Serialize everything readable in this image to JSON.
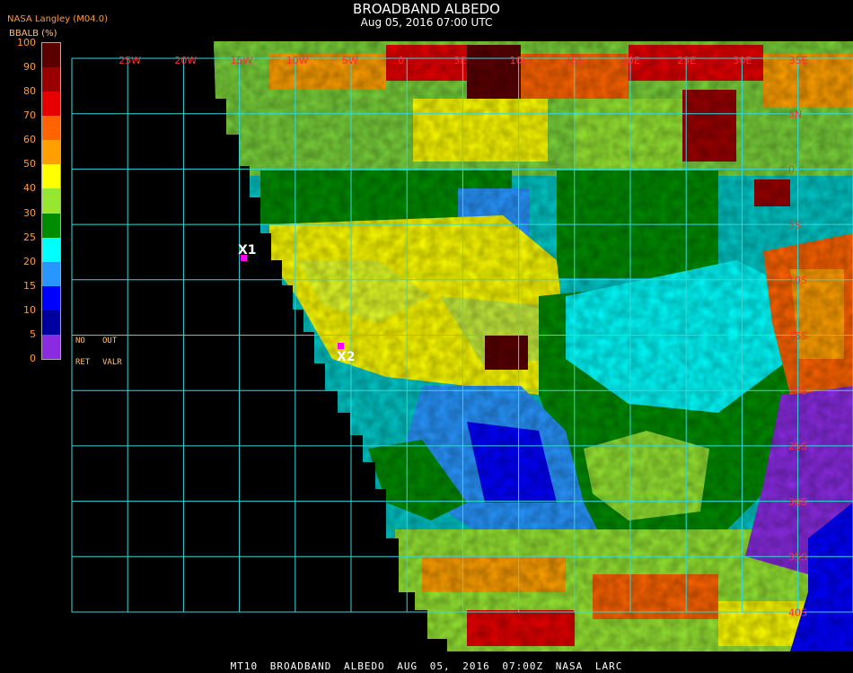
{
  "header": {
    "title": "BROADBAND ALBEDO",
    "subtitle": "Aug 05, 2016 07:00 UTC",
    "agency": "NASA Langley (M04.0)",
    "unit_label": "BBALB (%)"
  },
  "colorbar": {
    "ticks": [
      "100",
      "90",
      "80",
      "70",
      "60",
      "50",
      "40",
      "30",
      "25",
      "20",
      "15",
      "10",
      "5",
      "0"
    ],
    "colors": [
      "#5a0000",
      "#9b0000",
      "#e60000",
      "#ff6400",
      "#ffa000",
      "#ffff00",
      "#96e632",
      "#008c00",
      "#00ffff",
      "#2896ff",
      "#0000ff",
      "#0000a0",
      "#8a2be2"
    ],
    "no_ret": [
      "NO",
      "RET"
    ],
    "out_valr": [
      "OUT",
      "VALR"
    ]
  },
  "map": {
    "lon_labels": [
      "25W",
      "20W",
      "15W",
      "10W",
      "5W",
      "0",
      "5E",
      "10E",
      "15E",
      "20E",
      "25E",
      "30E",
      "35E"
    ],
    "lat_labels": [
      "5N",
      "0",
      "5S",
      "10S",
      "15S",
      "20S",
      "25S",
      "30S",
      "35S",
      "40S"
    ],
    "markers": [
      {
        "label": "X1",
        "color": "#ff00ff"
      },
      {
        "label": "X2",
        "color": "#ff00ff"
      }
    ]
  },
  "footer": {
    "text": "MT10 BROADBAND ALBEDO AUG 05, 2016 07:00Z NASA LARC"
  }
}
